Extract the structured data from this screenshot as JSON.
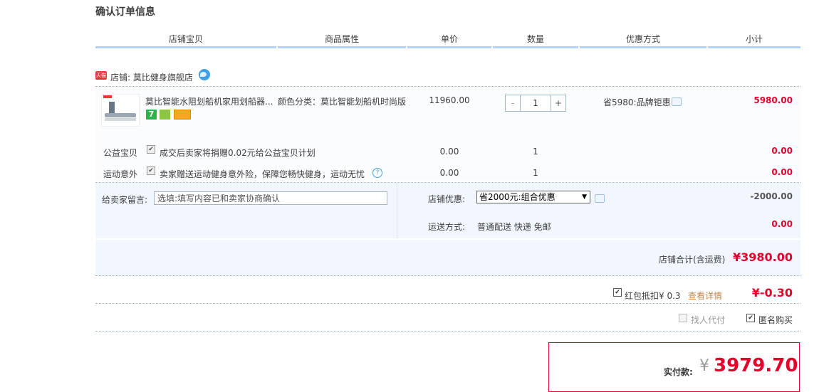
{
  "page_title": "确认订单信息",
  "columns": [
    "店铺宝贝",
    "商品属性",
    "单价",
    "数量",
    "优惠方式",
    "小计"
  ],
  "shop": {
    "badge": "天猫",
    "label": "店铺: 莫比健身旗舰店"
  },
  "item": {
    "name": "莫比智能水阻划船机家用划船器...",
    "attr": "颜色分类：莫比智能划船机时尚版",
    "price": "11960.00",
    "quantity": "1",
    "minus": "-",
    "plus": "+",
    "discount": "省5980:品牌钜惠",
    "subtotal": "5980.00",
    "icons": [
      "seven-day-return-icon",
      "badge-icon",
      "credit-card-icon"
    ]
  },
  "services": [
    {
      "label": "公益宝贝",
      "text": "成交后卖家将捐赠0.02元给公益宝贝计划",
      "price": "0.00",
      "qty": "1",
      "subtotal": "0.00"
    },
    {
      "label": "运动意外",
      "text": "卖家赠送运动健身意外险，保障您畅快健身，运动无忧",
      "price": "0.00",
      "qty": "1",
      "subtotal": "0.00"
    }
  ],
  "message": {
    "label": "给卖家留言:",
    "placeholder": "选填:填写内容已和卖家协商确认"
  },
  "shop_discount": {
    "label": "店铺优惠:",
    "selected": "省2000元:组合优惠",
    "amount": "-2000.00"
  },
  "shipping": {
    "label": "运送方式:",
    "value": "普通配送 快递 免邮",
    "amount": "0.00"
  },
  "shop_total": {
    "label": "店铺合计(含运费)",
    "value": "¥3980.00"
  },
  "red_packet": {
    "label": "红包抵扣¥ 0.3",
    "link": "查看详情",
    "amount": "¥-0.30"
  },
  "options": {
    "proxy_pay": "找人代付",
    "anonymous": "匿名购买"
  },
  "payment": {
    "label": "实付款:",
    "currency": "¥",
    "value": "3979.70"
  },
  "colors": {
    "accent_red": "#e4002b",
    "header_line": "#b2d1ff",
    "band_bg": "#f2f7ff"
  }
}
